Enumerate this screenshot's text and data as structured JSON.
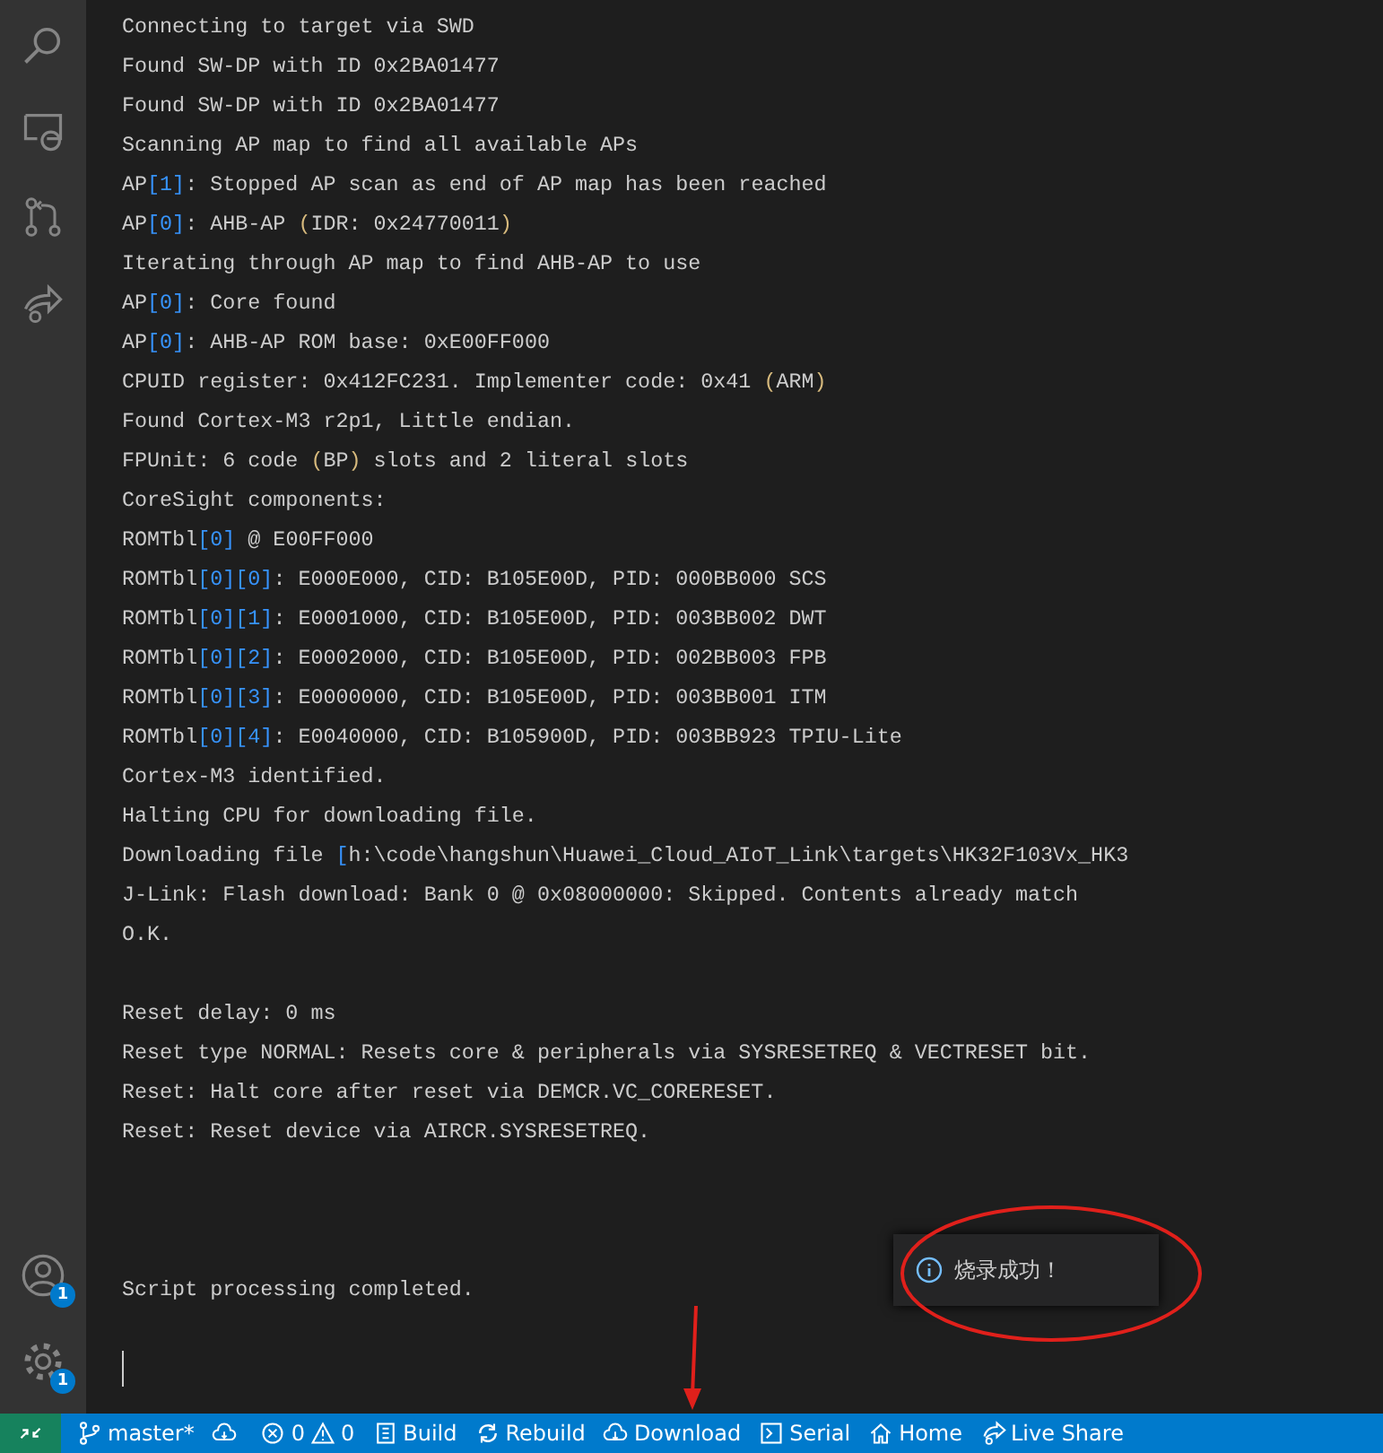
{
  "activity_bar": {
    "badges": [
      "1",
      "1"
    ]
  },
  "terminal": {
    "lines": [
      {
        "kind": "text",
        "segs": [
          {
            "t": "Connecting to target via SWD",
            "kind": "plain"
          }
        ]
      },
      {
        "kind": "text",
        "segs": [
          {
            "t": "Found SW-DP with ID 0x2BA01477",
            "kind": "plain"
          }
        ]
      },
      {
        "kind": "text",
        "segs": [
          {
            "t": "Found SW-DP with ID 0x2BA01477",
            "kind": "plain"
          }
        ]
      },
      {
        "kind": "text",
        "segs": [
          {
            "t": "Scanning AP map to find all available APs",
            "kind": "plain"
          }
        ]
      },
      {
        "kind": "text",
        "segs": [
          {
            "t": "AP",
            "kind": "plain"
          },
          {
            "t": "[1]",
            "kind": "bracket"
          },
          {
            "t": ": Stopped AP scan as end of AP map has been reached",
            "kind": "plain"
          }
        ]
      },
      {
        "kind": "text",
        "segs": [
          {
            "t": "AP",
            "kind": "plain"
          },
          {
            "t": "[0]",
            "kind": "bracket"
          },
          {
            "t": ": AHB-AP ",
            "kind": "plain"
          },
          {
            "t": "(",
            "kind": "paren"
          },
          {
            "t": "IDR: 0x24770011",
            "kind": "plain"
          },
          {
            "t": ")",
            "kind": "paren"
          }
        ]
      },
      {
        "kind": "text",
        "segs": [
          {
            "t": "Iterating through AP map to find AHB-AP to use",
            "kind": "plain"
          }
        ]
      },
      {
        "kind": "text",
        "segs": [
          {
            "t": "AP",
            "kind": "plain"
          },
          {
            "t": "[0]",
            "kind": "bracket"
          },
          {
            "t": ": Core found",
            "kind": "plain"
          }
        ]
      },
      {
        "kind": "text",
        "segs": [
          {
            "t": "AP",
            "kind": "plain"
          },
          {
            "t": "[0]",
            "kind": "bracket"
          },
          {
            "t": ": AHB-AP ROM base: 0xE00FF000",
            "kind": "plain"
          }
        ]
      },
      {
        "kind": "text",
        "segs": [
          {
            "t": "CPUID register: 0x412FC231. Implementer code: 0x41 ",
            "kind": "plain"
          },
          {
            "t": "(",
            "kind": "paren"
          },
          {
            "t": "ARM",
            "kind": "plain"
          },
          {
            "t": ")",
            "kind": "paren"
          }
        ]
      },
      {
        "kind": "text",
        "segs": [
          {
            "t": "Found Cortex-M3 r2p1, Little endian.",
            "kind": "plain"
          }
        ]
      },
      {
        "kind": "text",
        "segs": [
          {
            "t": "FPUnit: 6 code ",
            "kind": "plain"
          },
          {
            "t": "(",
            "kind": "paren"
          },
          {
            "t": "BP",
            "kind": "plain"
          },
          {
            "t": ")",
            "kind": "paren"
          },
          {
            "t": " slots and 2 literal slots",
            "kind": "plain"
          }
        ]
      },
      {
        "kind": "text",
        "segs": [
          {
            "t": "CoreSight components:",
            "kind": "plain"
          }
        ]
      },
      {
        "kind": "text",
        "segs": [
          {
            "t": "ROMTbl",
            "kind": "plain"
          },
          {
            "t": "[0]",
            "kind": "bracket"
          },
          {
            "t": " @ E00FF000",
            "kind": "plain"
          }
        ]
      },
      {
        "kind": "text",
        "segs": [
          {
            "t": "ROMTbl",
            "kind": "plain"
          },
          {
            "t": "[0][0]",
            "kind": "bracket"
          },
          {
            "t": ": E000E000, CID: B105E00D, PID: 000BB000 SCS",
            "kind": "plain"
          }
        ]
      },
      {
        "kind": "text",
        "segs": [
          {
            "t": "ROMTbl",
            "kind": "plain"
          },
          {
            "t": "[0][1]",
            "kind": "bracket"
          },
          {
            "t": ": E0001000, CID: B105E00D, PID: 003BB002 DWT",
            "kind": "plain"
          }
        ]
      },
      {
        "kind": "text",
        "segs": [
          {
            "t": "ROMTbl",
            "kind": "plain"
          },
          {
            "t": "[0][2]",
            "kind": "bracket"
          },
          {
            "t": ": E0002000, CID: B105E00D, PID: 002BB003 FPB",
            "kind": "plain"
          }
        ]
      },
      {
        "kind": "text",
        "segs": [
          {
            "t": "ROMTbl",
            "kind": "plain"
          },
          {
            "t": "[0][3]",
            "kind": "bracket"
          },
          {
            "t": ": E0000000, CID: B105E00D, PID: 003BB001 ITM",
            "kind": "plain"
          }
        ]
      },
      {
        "kind": "text",
        "segs": [
          {
            "t": "ROMTbl",
            "kind": "plain"
          },
          {
            "t": "[0][4]",
            "kind": "bracket"
          },
          {
            "t": ": E0040000, CID: B105900D, PID: 003BB923 TPIU-Lite",
            "kind": "plain"
          }
        ]
      },
      {
        "kind": "text",
        "segs": [
          {
            "t": "Cortex-M3 identified.",
            "kind": "plain"
          }
        ]
      },
      {
        "kind": "text",
        "segs": [
          {
            "t": "Halting CPU for downloading file.",
            "kind": "plain"
          }
        ]
      },
      {
        "kind": "text",
        "segs": [
          {
            "t": "Downloading file ",
            "kind": "plain"
          },
          {
            "t": "[",
            "kind": "bracket"
          },
          {
            "t": "h:\\code\\hangshun\\Huawei_Cloud_AIoT_Link\\targets\\HK32F103Vx_HK3",
            "kind": "plain"
          }
        ]
      },
      {
        "kind": "text",
        "segs": [
          {
            "t": "J-Link: Flash download: Bank 0 @ 0x08000000: Skipped. Contents already match",
            "kind": "plain"
          }
        ]
      },
      {
        "kind": "text",
        "segs": [
          {
            "t": "O.K.",
            "kind": "plain"
          }
        ]
      },
      {
        "kind": "blank"
      },
      {
        "kind": "text",
        "segs": [
          {
            "t": "Reset delay: 0 ms",
            "kind": "plain"
          }
        ]
      },
      {
        "kind": "text",
        "segs": [
          {
            "t": "Reset type NORMAL: Resets core & peripherals via SYSRESETREQ & VECTRESET bit.",
            "kind": "plain"
          }
        ]
      },
      {
        "kind": "text",
        "segs": [
          {
            "t": "Reset: Halt core after reset via DEMCR.VC_CORERESET.",
            "kind": "plain"
          }
        ]
      },
      {
        "kind": "text",
        "segs": [
          {
            "t": "Reset: Reset device via AIRCR.SYSRESETREQ.",
            "kind": "plain"
          }
        ]
      },
      {
        "kind": "blank"
      },
      {
        "kind": "blank"
      },
      {
        "kind": "blank"
      },
      {
        "kind": "text",
        "segs": [
          {
            "t": "Script processing completed.",
            "kind": "plain"
          }
        ]
      },
      {
        "kind": "blank"
      },
      {
        "kind": "cursor"
      }
    ]
  },
  "notification": {
    "message": "烧录成功！"
  },
  "status_bar": {
    "items": [
      {
        "kind": "branch",
        "label": "master*"
      },
      {
        "kind": "sync"
      },
      {
        "kind": "problems",
        "errors": "0",
        "warnings": "0"
      },
      {
        "kind": "build",
        "label": "Build"
      },
      {
        "kind": "rebuild",
        "label": "Rebuild"
      },
      {
        "kind": "download",
        "label": "Download"
      },
      {
        "kind": "serial",
        "label": "Serial"
      },
      {
        "kind": "home",
        "label": "Home"
      },
      {
        "kind": "share",
        "label": "Live Share"
      }
    ]
  }
}
